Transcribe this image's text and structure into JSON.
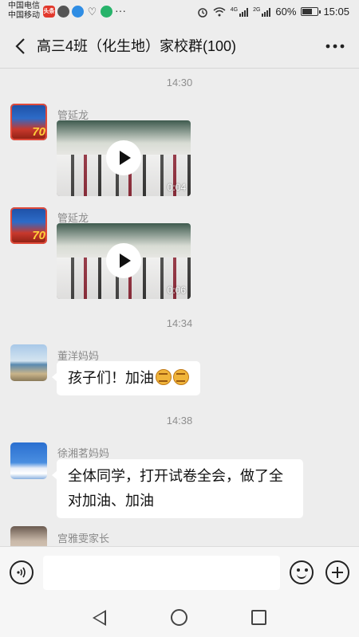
{
  "status_bar": {
    "carrier_1": "中国电信",
    "carrier_2": "中国移动",
    "news_badge": "头条",
    "signal_1_label": "4G",
    "signal_2_label": "2G",
    "battery": "60%",
    "time": "15:05",
    "notif_more": "···"
  },
  "header": {
    "title": "高三4班（化生地）家校群(100)",
    "more": "···"
  },
  "messages": [
    {
      "type": "time",
      "text": "14:30"
    },
    {
      "type": "video",
      "sender": "管延龙",
      "duration": "0:04"
    },
    {
      "type": "video",
      "sender": "管延龙",
      "duration": "0:06"
    },
    {
      "type": "time",
      "text": "14:34"
    },
    {
      "type": "text",
      "sender": "董洋妈妈",
      "text": "孩子们！加油"
    },
    {
      "type": "time",
      "text": "14:38"
    },
    {
      "type": "text",
      "sender": "徐湘茗妈妈",
      "lines": [
        "全体同学，打开试卷全会，做了全",
        "对加油、加油"
      ]
    },
    {
      "type": "partial",
      "sender": "宫雅雯家长"
    }
  ],
  "avatar_badge": "70"
}
